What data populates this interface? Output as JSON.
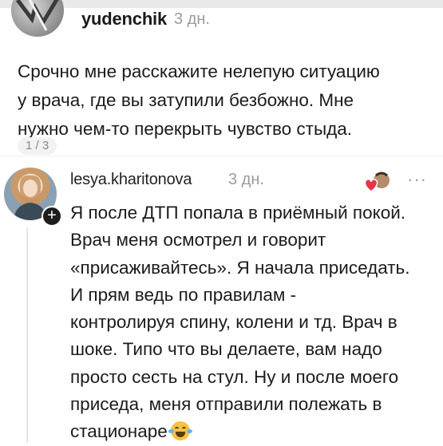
{
  "post": {
    "author": "yudenchik",
    "time": "3 дн.",
    "text": "Срочно мне расскажите нелепую ситуацию\nу врача, где вы затупили безбожно. Мне\nнужно чем-то перекрыть чувство стыда.",
    "pager": "1 / 3"
  },
  "reply": {
    "author": "lesya.kharitonova",
    "time": "3 дн.",
    "more": "···",
    "text": "Я после ДТП попала в приёмный покой.\nВрач меня осмотрел и говорит\n«присаживайтесь». Я начала приседать.\nИ прям ведь по правилам -\nконтролируя спину, колени и тд. Врач в\nшоке. Типо что вы делаете, вам надо\nпросто сесть на стул. Ну и после моего\nприседа, меня отправили полежать в\nстационаре",
    "emoji": "laughing-crying-emoji",
    "follow_badge": "+"
  },
  "icons": {
    "liked_by_author": "heart-with-avatar-icon",
    "more": "more-dots-icon"
  },
  "colors": {
    "text": "#1b1b1b",
    "meta": "#9b9b9b",
    "heart": "#e8334a",
    "badge": "#1d1d1d"
  }
}
